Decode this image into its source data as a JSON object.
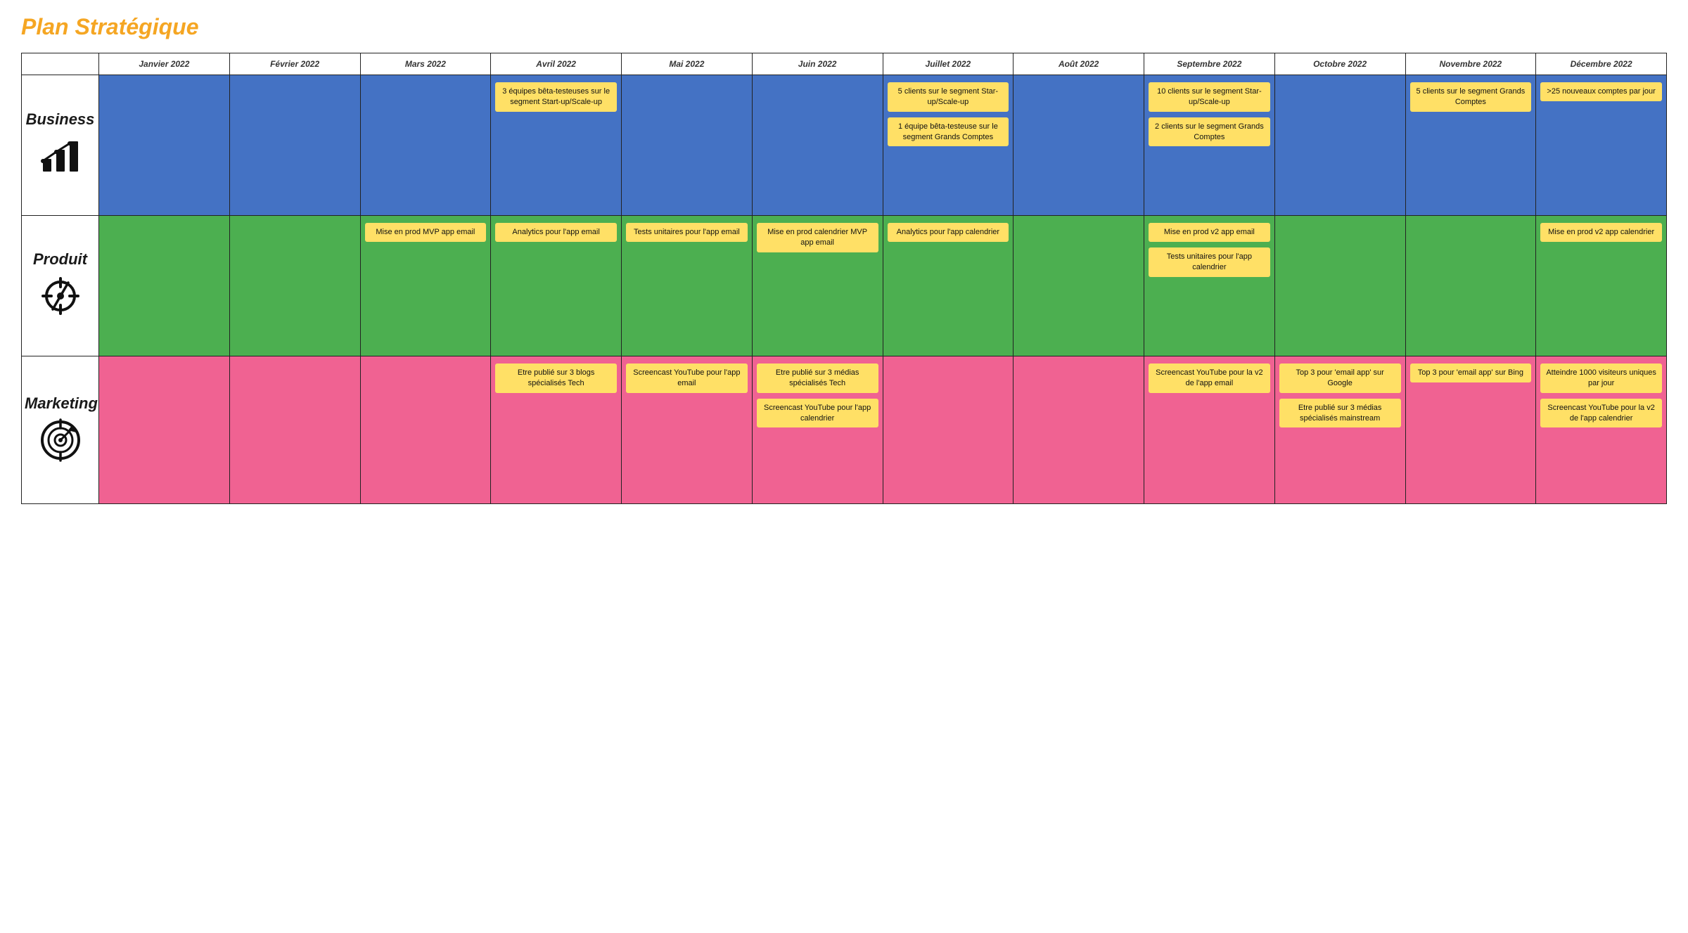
{
  "title": "Plan Stratégique",
  "months": [
    "Janvier 2022",
    "Février 2022",
    "Mars 2022",
    "Avril 2022",
    "Mai 2022",
    "Juin 2022",
    "Juillet 2022",
    "Août 2022",
    "Septembre 2022",
    "Octobre 2022",
    "Novembre 2022",
    "Décembre 2022"
  ],
  "rows": [
    {
      "id": "business",
      "label": "Business",
      "bg": "bg-blue",
      "notes": {
        "3": [
          "3 équipes bêta-testeuses sur le segment Start-up/Scale-up"
        ],
        "6": [
          "5 clients sur le segment Star-up/Scale-up",
          "1 équipe bêta-testeuse sur le segment Grands Comptes"
        ],
        "8": [
          "10 clients sur le segment Star-up/Scale-up",
          "2 clients sur le segment Grands Comptes"
        ],
        "10": [
          "5 clients sur le segment Grands Comptes"
        ],
        "11": [
          ">25 nouveaux comptes par jour"
        ]
      }
    },
    {
      "id": "produit",
      "label": "Produit",
      "bg": "bg-green",
      "notes": {
        "2": [
          "Mise en prod MVP app email"
        ],
        "3": [
          "Analytics pour l'app email"
        ],
        "4": [
          "Tests unitaires pour l'app email"
        ],
        "5": [
          "Mise en prod calendrier MVP app email"
        ],
        "6": [
          "Analytics pour l'app calendrier"
        ],
        "8": [
          "Mise en prod v2 app email",
          "Tests unitaires pour l'app calendrier"
        ],
        "11": [
          "Mise en prod v2 app calendrier"
        ]
      }
    },
    {
      "id": "marketing",
      "label": "Marketing",
      "bg": "bg-pink",
      "notes": {
        "3": [
          "Etre publié sur 3 blogs spécialisés Tech"
        ],
        "4": [
          "Screencast YouTube pour l'app email"
        ],
        "5": [
          "Etre publié sur 3 médias spécialisés Tech",
          "Screencast YouTube pour l'app calendrier"
        ],
        "8": [
          "Screencast YouTube pour la v2 de l'app email"
        ],
        "9": [
          "Top 3 pour 'email app' sur Google",
          "Etre publié sur 3 médias spécialisés mainstream"
        ],
        "10": [
          "Top 3 pour 'email app' sur Bing"
        ],
        "11": [
          "Atteindre 1000 visiteurs uniques par jour",
          "Screencast YouTube pour la v2 de l'app calendrier"
        ]
      }
    }
  ]
}
